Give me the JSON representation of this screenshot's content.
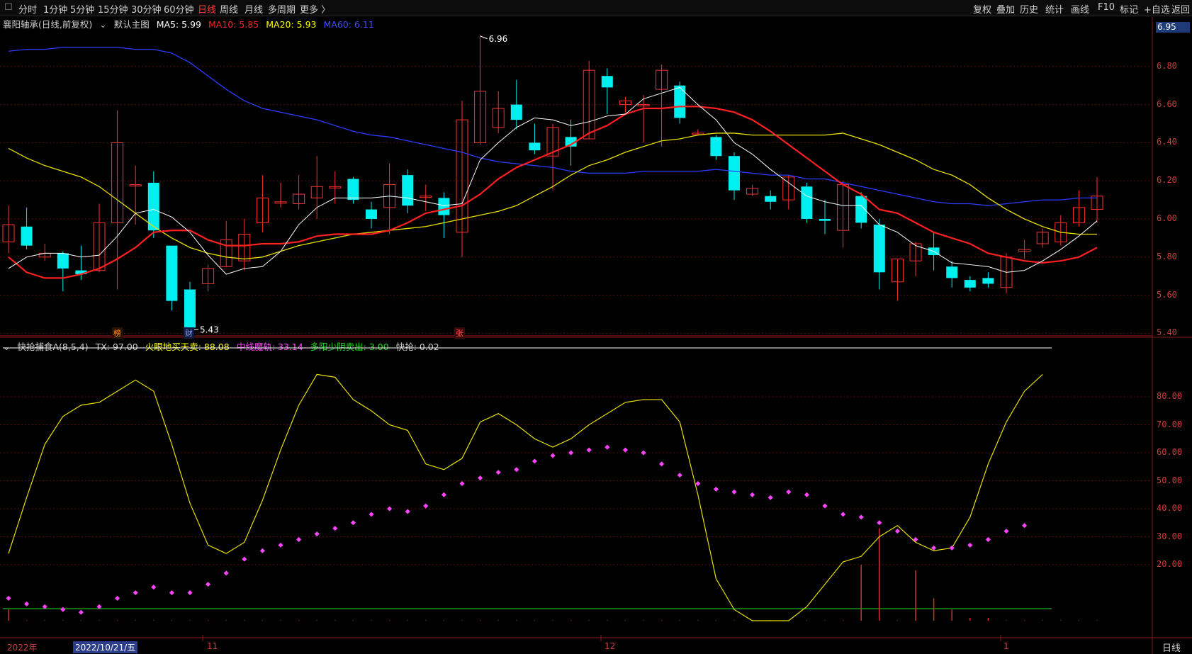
{
  "toolbar": {
    "left_icon": "box-icon",
    "periods": [
      "分时",
      "1分钟",
      "5分钟",
      "15分钟",
      "30分钟",
      "60分钟",
      "日线",
      "周线",
      "月线",
      "多周期",
      "更多 〉"
    ],
    "active_period": "日线",
    "right_buttons": [
      "复权",
      "叠加",
      "历史",
      "统计",
      "画线",
      "F10",
      "标记",
      "+自选",
      "返回"
    ]
  },
  "main_info": {
    "title": "襄阳轴承(日线,前复权)",
    "template": "默认主图",
    "ma5": "MA5: 5.99",
    "ma10": "MA10: 5.85",
    "ma20": "MA20: 5.93",
    "ma60": "MA60: 6.11",
    "colors": {
      "ma5": "#ffffff",
      "ma10": "#ff2020",
      "ma20": "#ffff00",
      "ma60": "#2c3cff"
    }
  },
  "main_axis": {
    "current_price": "6.95",
    "ticks": [
      "6.80",
      "6.60",
      "6.40",
      "6.20",
      "6.00",
      "5.80",
      "5.60",
      "5.40"
    ],
    "high_label": "6.96",
    "low_label": "5.43"
  },
  "markers": [
    "榜",
    "财",
    "张"
  ],
  "sub_info": {
    "title": "快抢捕食A(8,5,4)",
    "tx": "TX: 97.00",
    "s1": "火眼地买天卖: 88.08",
    "s2": "中线魔轨: 33.14",
    "s3": "多阳少阴卖出: 3.00",
    "s4": "快抢: 0.02",
    "colors": {
      "s1": "#ffff00",
      "s2": "#ff44ff",
      "s3": "#22dd22",
      "s4": "#c8c8c8"
    }
  },
  "sub_axis": {
    "ticks": [
      "80.00",
      "70.00",
      "60.00",
      "50.00",
      "40.00",
      "30.00",
      "20.00"
    ]
  },
  "date_axis": {
    "labels": [
      "2022年",
      "11",
      "12",
      "1"
    ],
    "selected_date": "2022/10/21/五"
  },
  "side_button": "日线",
  "candles": [
    [
      5.88,
      5.97,
      5.82,
      6.07
    ],
    [
      5.96,
      5.86,
      5.84,
      6.06
    ],
    [
      5.8,
      5.82,
      5.78,
      5.87
    ],
    [
      5.82,
      5.74,
      5.62,
      5.83
    ],
    [
      5.73,
      5.71,
      5.68,
      5.86
    ],
    [
      5.73,
      5.98,
      5.72,
      6.08
    ],
    [
      5.98,
      6.4,
      5.63,
      6.57
    ],
    [
      6.18,
      6.18,
      5.97,
      6.28
    ],
    [
      6.19,
      5.94,
      5.9,
      6.25
    ],
    [
      5.86,
      5.57,
      5.52,
      5.86
    ],
    [
      5.63,
      5.43,
      5.42,
      5.67
    ],
    [
      5.66,
      5.74,
      5.62,
      5.76
    ],
    [
      5.75,
      5.89,
      5.75,
      5.99
    ],
    [
      5.78,
      5.92,
      5.73,
      6.0
    ],
    [
      5.98,
      6.11,
      5.93,
      6.23
    ],
    [
      6.09,
      6.09,
      6.06,
      6.19
    ],
    [
      6.08,
      6.13,
      6.05,
      6.23
    ],
    [
      6.11,
      6.17,
      6.0,
      6.33
    ],
    [
      6.17,
      6.17,
      6.08,
      6.25
    ],
    [
      6.21,
      6.1,
      6.08,
      6.22
    ],
    [
      6.05,
      6.0,
      5.95,
      6.09
    ],
    [
      6.06,
      6.18,
      5.92,
      6.29
    ],
    [
      6.23,
      6.07,
      6.03,
      6.26
    ],
    [
      6.12,
      6.12,
      6.04,
      6.18
    ],
    [
      6.11,
      6.02,
      5.9,
      6.14
    ],
    [
      5.93,
      6.52,
      5.8,
      6.62
    ],
    [
      6.4,
      6.67,
      6.39,
      6.96
    ],
    [
      6.48,
      6.58,
      6.45,
      6.67
    ],
    [
      6.6,
      6.52,
      6.47,
      6.73
    ],
    [
      6.4,
      6.36,
      6.34,
      6.5
    ],
    [
      6.33,
      6.48,
      6.15,
      6.5
    ],
    [
      6.43,
      6.38,
      6.28,
      6.52
    ],
    [
      6.42,
      6.78,
      6.42,
      6.83
    ],
    [
      6.75,
      6.69,
      6.55,
      6.79
    ],
    [
      6.6,
      6.62,
      6.56,
      6.64
    ],
    [
      6.6,
      6.6,
      6.4,
      6.65
    ],
    [
      6.68,
      6.78,
      6.38,
      6.81
    ],
    [
      6.7,
      6.53,
      6.5,
      6.72
    ],
    [
      6.45,
      6.45,
      6.44,
      6.47
    ],
    [
      6.43,
      6.33,
      6.31,
      6.44
    ],
    [
      6.33,
      6.15,
      6.1,
      6.35
    ],
    [
      6.13,
      6.16,
      6.12,
      6.18
    ],
    [
      6.12,
      6.09,
      6.05,
      6.15
    ],
    [
      6.1,
      6.22,
      6.05,
      6.23
    ],
    [
      6.17,
      6.0,
      5.98,
      6.19
    ],
    [
      6.0,
      5.99,
      5.92,
      6.1
    ],
    [
      5.94,
      6.18,
      5.85,
      6.2
    ],
    [
      6.12,
      5.98,
      5.95,
      6.14
    ],
    [
      5.97,
      5.72,
      5.63,
      6.0
    ],
    [
      5.67,
      5.79,
      5.57,
      5.79
    ],
    [
      5.78,
      5.87,
      5.7,
      5.88
    ],
    [
      5.85,
      5.81,
      5.73,
      5.93
    ],
    [
      5.75,
      5.69,
      5.64,
      5.78
    ],
    [
      5.68,
      5.64,
      5.62,
      5.7
    ],
    [
      5.69,
      5.66,
      5.64,
      5.72
    ],
    [
      5.64,
      5.8,
      5.61,
      5.82
    ],
    [
      5.83,
      5.84,
      5.79,
      5.89
    ],
    [
      5.87,
      5.93,
      5.85,
      5.95
    ],
    [
      5.88,
      5.98,
      5.86,
      6.02
    ],
    [
      5.98,
      6.06,
      5.96,
      6.15
    ],
    [
      6.05,
      6.12,
      5.98,
      6.22
    ]
  ],
  "ma5": [
    5.74,
    5.8,
    5.82,
    5.82,
    5.8,
    5.81,
    5.91,
    6.03,
    6.05,
    6.01,
    5.93,
    5.81,
    5.71,
    5.74,
    5.75,
    5.83,
    5.97,
    6.06,
    6.11,
    6.11,
    6.11,
    6.12,
    6.11,
    6.09,
    6.07,
    6.08,
    6.31,
    6.4,
    6.48,
    6.53,
    6.52,
    6.49,
    6.51,
    6.54,
    6.55,
    6.63,
    6.66,
    6.69,
    6.6,
    6.52,
    6.4,
    6.34,
    6.26,
    6.19,
    6.12,
    6.09,
    6.07,
    6.07,
    5.97,
    5.93,
    5.86,
    5.83,
    5.77,
    5.76,
    5.75,
    5.72,
    5.73,
    5.78,
    5.84,
    5.91,
    5.99
  ],
  "ma10": [
    5.8,
    5.72,
    5.69,
    5.69,
    5.71,
    5.74,
    5.79,
    5.85,
    5.93,
    5.94,
    5.94,
    5.89,
    5.86,
    5.86,
    5.87,
    5.87,
    5.88,
    5.91,
    5.92,
    5.92,
    5.92,
    5.94,
    5.98,
    6.03,
    6.05,
    6.07,
    6.13,
    6.21,
    6.27,
    6.31,
    6.35,
    6.39,
    6.45,
    6.49,
    6.55,
    6.58,
    6.58,
    6.59,
    6.59,
    6.58,
    6.56,
    6.52,
    6.46,
    6.39,
    6.32,
    6.25,
    6.18,
    6.13,
    6.05,
    6.03,
    5.98,
    5.93,
    5.9,
    5.87,
    5.82,
    5.8,
    5.78,
    5.77,
    5.78,
    5.8,
    5.85
  ],
  "ma20": [
    6.37,
    6.32,
    6.28,
    6.25,
    6.22,
    6.17,
    6.1,
    6.03,
    5.96,
    5.9,
    5.85,
    5.82,
    5.8,
    5.79,
    5.8,
    5.83,
    5.86,
    5.88,
    5.9,
    5.92,
    5.93,
    5.94,
    5.95,
    5.96,
    5.98,
    6.0,
    6.02,
    6.04,
    6.07,
    6.12,
    6.17,
    6.23,
    6.28,
    6.31,
    6.35,
    6.38,
    6.41,
    6.42,
    6.44,
    6.45,
    6.45,
    6.44,
    6.44,
    6.44,
    6.44,
    6.44,
    6.45,
    6.42,
    6.39,
    6.35,
    6.31,
    6.26,
    6.23,
    6.18,
    6.11,
    6.05,
    6.0,
    5.96,
    5.93,
    5.92,
    5.92
  ],
  "ma60": [
    6.88,
    6.89,
    6.89,
    6.9,
    6.9,
    6.9,
    6.9,
    6.89,
    6.89,
    6.87,
    6.82,
    6.75,
    6.68,
    6.62,
    6.58,
    6.56,
    6.54,
    6.52,
    6.49,
    6.46,
    6.44,
    6.43,
    6.41,
    6.39,
    6.37,
    6.35,
    6.32,
    6.3,
    6.29,
    6.28,
    6.27,
    6.25,
    6.24,
    6.24,
    6.24,
    6.25,
    6.25,
    6.25,
    6.25,
    6.26,
    6.25,
    6.24,
    6.23,
    6.23,
    6.21,
    6.21,
    6.19,
    6.17,
    6.15,
    6.13,
    6.11,
    6.09,
    6.08,
    6.08,
    6.07,
    6.08,
    6.09,
    6.1,
    6.1,
    6.11,
    6.11
  ],
  "yellow": [
    24,
    44,
    63,
    73,
    77,
    78,
    82,
    86,
    82,
    63,
    42,
    27,
    24,
    28,
    43,
    61,
    77,
    88,
    87,
    79,
    75,
    70,
    68,
    56,
    54,
    58,
    71,
    74,
    70,
    65,
    62,
    65,
    70,
    74,
    78,
    79,
    79,
    71,
    45,
    15,
    4,
    0,
    0,
    0,
    5,
    13,
    21,
    23,
    30,
    34,
    28,
    25,
    26,
    37,
    56,
    71,
    82,
    88
  ],
  "pink": [
    8,
    6,
    5,
    4,
    3,
    5,
    8,
    10,
    12,
    10,
    10,
    13,
    17,
    22,
    25,
    27,
    29,
    31,
    33,
    35,
    38,
    40,
    39,
    41,
    45,
    49,
    51,
    53,
    54,
    57,
    59,
    60,
    61,
    62,
    61,
    60,
    56,
    52,
    49,
    47,
    46,
    45,
    44,
    46,
    45,
    41,
    38,
    37,
    35,
    32,
    29,
    26,
    26,
    27,
    29,
    32,
    34
  ],
  "bars": [
    4,
    0,
    0,
    0,
    0,
    0,
    0,
    0,
    0,
    0,
    0,
    0,
    0,
    0,
    0,
    0,
    0,
    0,
    0,
    0,
    0,
    0,
    0,
    0,
    0,
    0,
    0,
    0,
    0,
    0,
    0,
    0,
    0,
    0,
    0,
    0,
    0,
    0,
    0,
    0,
    0,
    0,
    0,
    0,
    0,
    0,
    0,
    20,
    33,
    0,
    18,
    8,
    4,
    1,
    1,
    0,
    0,
    0,
    0,
    0,
    0
  ]
}
